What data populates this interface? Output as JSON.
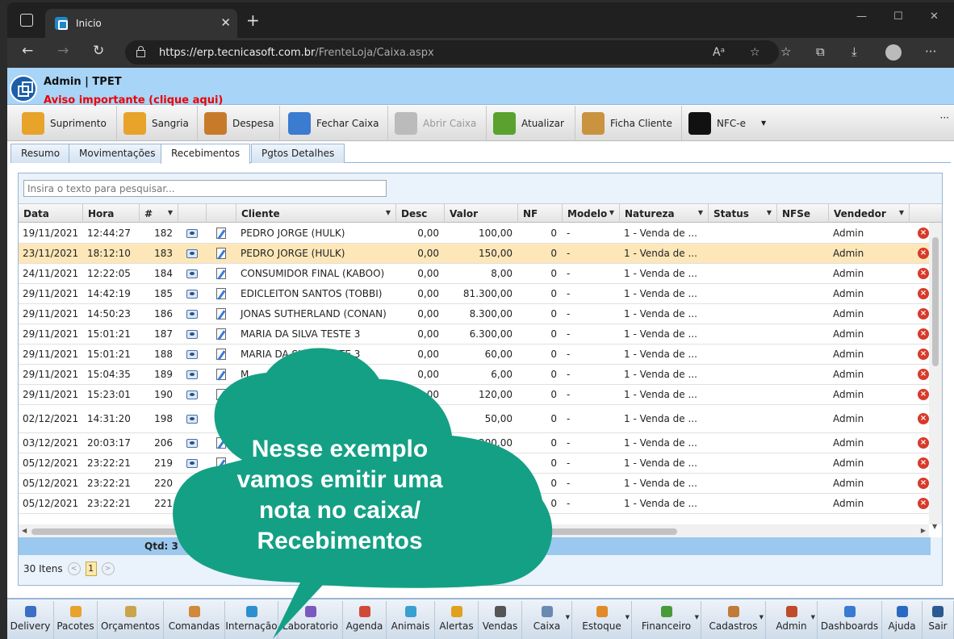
{
  "browser": {
    "tab_title": "Inicio",
    "url_domain": "https://erp.tecnicasoft.com.br",
    "url_path": "/FrenteLoja/Caixa.aspx"
  },
  "app": {
    "user": "Admin | TPET",
    "aviso": "Aviso importante (clique aqui)"
  },
  "toolbar": [
    {
      "label": "Suprimento",
      "icon": "supply-icon",
      "color": "#e7a32a",
      "disabled": false
    },
    {
      "label": "Sangria",
      "icon": "withdraw-icon",
      "color": "#e7a32a",
      "disabled": false
    },
    {
      "label": "Despesa",
      "icon": "coins-icon",
      "color": "#c77b2a",
      "disabled": false
    },
    {
      "label": "Fechar Caixa",
      "icon": "checkbox-icon",
      "color": "#3b7bd0",
      "disabled": false
    },
    {
      "label": "Abrir Caixa",
      "icon": "plus-circle-icon",
      "color": "#bbbbbb",
      "disabled": true
    },
    {
      "label": "Atualizar",
      "icon": "refresh-icon",
      "color": "#5aa22d",
      "disabled": false
    },
    {
      "label": "Ficha Cliente",
      "icon": "person-icon",
      "color": "#c99340",
      "disabled": false
    },
    {
      "label": "NFC-e",
      "icon": "qrcode-icon",
      "color": "#111111",
      "disabled": false
    }
  ],
  "tabs": [
    "Resumo",
    "Movimentações",
    "Recebimentos",
    "Pgtos Detalhes"
  ],
  "active_tab": "Recebimentos",
  "search": {
    "placeholder": "Insira o texto para pesquisar..."
  },
  "columns": [
    "Data",
    "Hora",
    "#",
    "",
    "",
    "Cliente",
    "Desc",
    "Valor",
    "NF",
    "Modelo",
    "Natureza",
    "Status",
    "NFSe",
    "Vendedor"
  ],
  "rows": [
    {
      "data": "19/11/2021",
      "hora": "12:44:27",
      "num": "182",
      "cliente": "PEDRO JORGE (HULK)",
      "desc": "0,00",
      "valor": "100,00",
      "nf": "0",
      "modelo": "-",
      "natureza": "1 - Venda de ...",
      "vendedor": "Admin"
    },
    {
      "data": "23/11/2021",
      "hora": "18:12:10",
      "num": "183",
      "cliente": "PEDRO JORGE (HULK)",
      "desc": "0,00",
      "valor": "150,00",
      "nf": "0",
      "modelo": "-",
      "natureza": "1 - Venda de ...",
      "vendedor": "Admin"
    },
    {
      "data": "24/11/2021",
      "hora": "12:22:05",
      "num": "184",
      "cliente": "CONSUMIDOR FINAL (KABOO)",
      "desc": "0,00",
      "valor": "8,00",
      "nf": "0",
      "modelo": "-",
      "natureza": "1 - Venda de ...",
      "vendedor": "Admin"
    },
    {
      "data": "29/11/2021",
      "hora": "14:42:19",
      "num": "185",
      "cliente": "EDICLEITON SANTOS (TOBBI)",
      "desc": "0,00",
      "valor": "81.300,00",
      "nf": "0",
      "modelo": "-",
      "natureza": "1 - Venda de ...",
      "vendedor": "Admin"
    },
    {
      "data": "29/11/2021",
      "hora": "14:50:23",
      "num": "186",
      "cliente": "JONAS SUTHERLAND (CONAN)",
      "desc": "0,00",
      "valor": "8.300,00",
      "nf": "0",
      "modelo": "-",
      "natureza": "1 - Venda de ...",
      "vendedor": "Admin"
    },
    {
      "data": "29/11/2021",
      "hora": "15:01:21",
      "num": "187",
      "cliente": "MARIA DA SILVA TESTE 3",
      "desc": "0,00",
      "valor": "6.300,00",
      "nf": "0",
      "modelo": "-",
      "natureza": "1 - Venda de ...",
      "vendedor": "Admin"
    },
    {
      "data": "29/11/2021",
      "hora": "15:01:21",
      "num": "188",
      "cliente": "MARIA DA SILVA TESTE 3",
      "desc": "0,00",
      "valor": "60,00",
      "nf": "0",
      "modelo": "-",
      "natureza": "1 - Venda de ...",
      "vendedor": "Admin"
    },
    {
      "data": "29/11/2021",
      "hora": "15:04:35",
      "num": "189",
      "cliente": "M",
      "desc": "0,00",
      "valor": "6,00",
      "nf": "0",
      "modelo": "-",
      "natureza": "1 - Venda de ...",
      "vendedor": "Admin"
    },
    {
      "data": "29/11/2021",
      "hora": "15:23:01",
      "num": "190",
      "cliente": "",
      "desc": "0,00",
      "valor": "120,00",
      "nf": "0",
      "modelo": "-",
      "natureza": "1 - Venda de ...",
      "vendedor": "Admin"
    },
    {
      "data": "02/12/2021",
      "hora": "14:31:20",
      "num": "198",
      "cliente": "",
      "desc": "",
      "valor": "50,00",
      "nf": "0",
      "modelo": "-",
      "natureza": "1 - Venda de ...",
      "vendedor": "Admin"
    },
    {
      "data": "03/12/2021",
      "hora": "20:03:17",
      "num": "206",
      "cliente": "",
      "desc": "",
      "valor": "200,00",
      "nf": "0",
      "modelo": "-",
      "natureza": "1 - Venda de ...",
      "vendedor": "Admin"
    },
    {
      "data": "05/12/2021",
      "hora": "23:22:21",
      "num": "219",
      "cliente": "",
      "desc": "",
      "valor": "",
      "nf": "0",
      "modelo": "-",
      "natureza": "1 - Venda de ...",
      "vendedor": "Admin"
    },
    {
      "data": "05/12/2021",
      "hora": "23:22:21",
      "num": "220",
      "cliente": "",
      "desc": "",
      "valor": "",
      "nf": "0",
      "modelo": "-",
      "natureza": "1 - Venda de ...",
      "vendedor": "Admin"
    },
    {
      "data": "05/12/2021",
      "hora": "23:22:21",
      "num": "221",
      "cliente": "",
      "desc": "",
      "valor": "",
      "nf": "0",
      "modelo": "-",
      "natureza": "1 - Venda de ...",
      "vendedor": "Admin"
    }
  ],
  "footer": {
    "qtd": "Qtd: 3"
  },
  "pager": {
    "count": "30 Itens",
    "page": "1"
  },
  "bottom_nav": [
    {
      "label": "Delivery",
      "icon": "delivery-icon",
      "color": "#3b6fc4"
    },
    {
      "label": "Pacotes",
      "icon": "package-icon",
      "color": "#e7a32a"
    },
    {
      "label": "Orçamentos",
      "icon": "document-icon",
      "color": "#c9a44a"
    },
    {
      "label": "Comandas",
      "icon": "notepad-icon",
      "color": "#d08a3a"
    },
    {
      "label": "Internação",
      "icon": "medical-icon",
      "color": "#2c8fd0"
    },
    {
      "label": "Laboratorio",
      "icon": "lab-icon",
      "color": "#7a5ac0"
    },
    {
      "label": "Agenda",
      "icon": "calendar-icon",
      "color": "#d04a3a"
    },
    {
      "label": "Animais",
      "icon": "paw-icon",
      "color": "#3aa0d0"
    },
    {
      "label": "Alertas",
      "icon": "warning-icon",
      "color": "#e0a020"
    },
    {
      "label": "Vendas",
      "icon": "cart-icon",
      "color": "#555555"
    },
    {
      "label": "Caixa",
      "icon": "register-icon",
      "color": "#6a8ab0"
    },
    {
      "label": "Estoque",
      "icon": "boxes-icon",
      "color": "#e08a2a"
    },
    {
      "label": "Financeiro",
      "icon": "money-icon",
      "color": "#4a9a3a"
    },
    {
      "label": "Cadastros",
      "icon": "pencil-icon",
      "color": "#c07a3a"
    },
    {
      "label": "Admin",
      "icon": "admin-icon",
      "color": "#c04a2a"
    },
    {
      "label": "Dashboards",
      "icon": "barchart-icon",
      "color": "#3a7ad0"
    },
    {
      "label": "Ajuda",
      "icon": "help-icon",
      "color": "#2a6ac0"
    },
    {
      "label": "Sair",
      "icon": "exit-icon",
      "color": "#2a5a90"
    }
  ],
  "callout": {
    "lines": [
      "Nesse exemplo",
      "vamos emitir uma",
      "nota no caixa/",
      "Recebimentos"
    ],
    "color": "#14a085"
  }
}
